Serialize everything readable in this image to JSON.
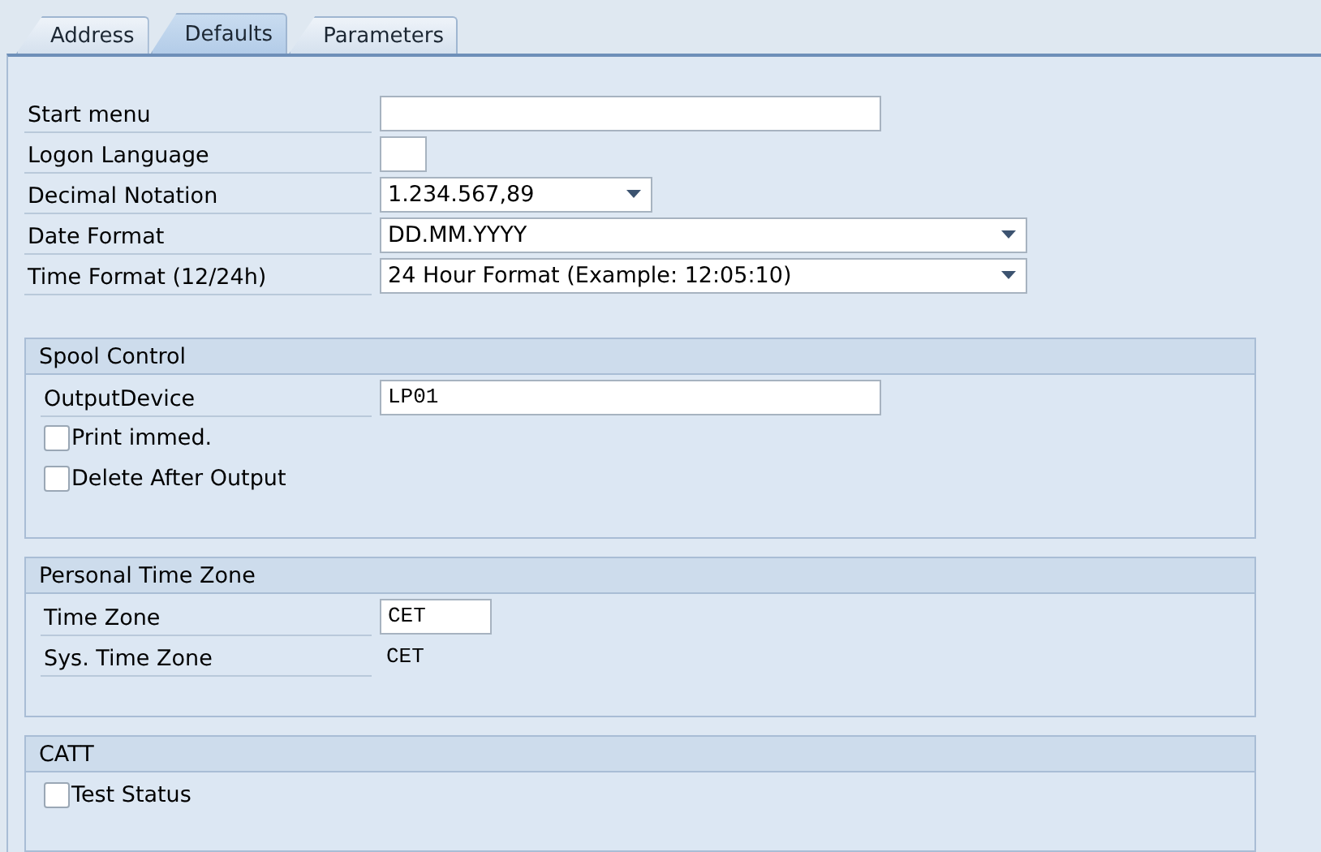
{
  "tabs": [
    {
      "label": "Address",
      "selected": false
    },
    {
      "label": "Defaults",
      "selected": true
    },
    {
      "label": "Parameters",
      "selected": false
    }
  ],
  "fields": [
    {
      "kind": "input",
      "label": "Start menu"
    },
    {
      "kind": "input",
      "label": "Logon Language"
    },
    {
      "kind": "dropdown",
      "label": "Decimal Notation",
      "value": "1.234.567,89"
    },
    {
      "kind": "dropdown",
      "label": "Date Format",
      "value": "DD.MM.YYYY"
    },
    {
      "kind": "dropdown",
      "label": "Time Format (12/24h)",
      "value": "24 Hour Format (Example: 12:05:10)"
    }
  ],
  "groups": [
    {
      "title": "Spool Control",
      "rows": [
        {
          "kind": "input",
          "label": "OutputDevice",
          "value": "LP01"
        },
        {
          "kind": "checkbox",
          "label": "Print immed.",
          "checked": false
        },
        {
          "kind": "checkbox",
          "label": "Delete After Output",
          "checked": false
        }
      ]
    },
    {
      "title": "Personal Time Zone",
      "rows": [
        {
          "kind": "input",
          "label": "Time Zone",
          "value": "CET"
        },
        {
          "kind": "display",
          "label": "Sys. Time Zone",
          "value": "CET"
        }
      ]
    },
    {
      "title": "CATT",
      "rows": [
        {
          "kind": "checkbox",
          "label": "Test Status",
          "checked": false
        }
      ]
    }
  ]
}
